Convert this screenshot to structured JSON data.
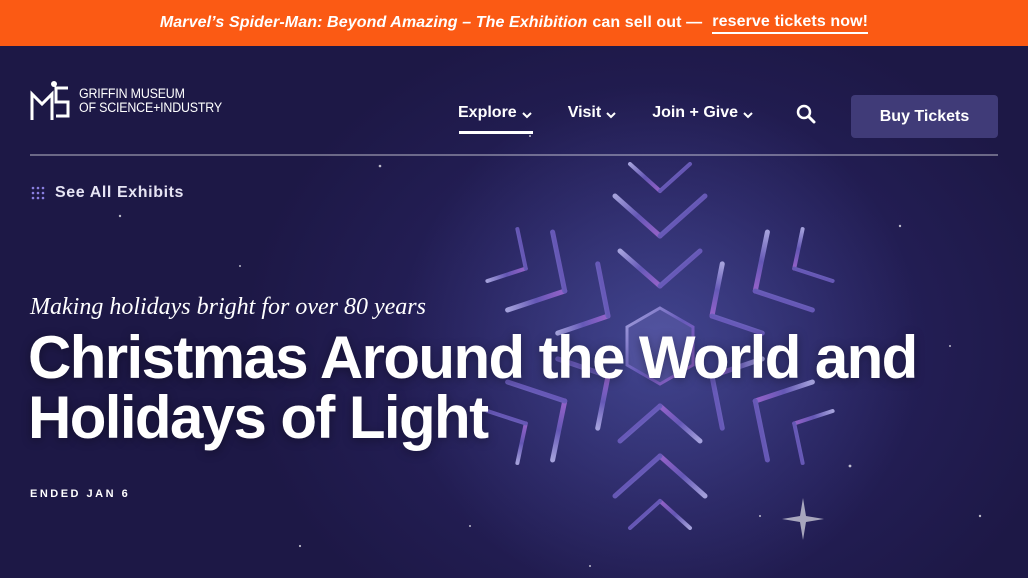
{
  "banner": {
    "italic_title": "Marvel’s Spider-Man: Beyond Amazing – The Exhibition",
    "text": "can sell out —",
    "link": "reserve tickets now!"
  },
  "logo": {
    "line1": "GRIFFIN MUSEUM",
    "line2": "OF SCIENCE+INDUSTRY"
  },
  "nav": {
    "items": [
      {
        "label": "Explore",
        "active": true
      },
      {
        "label": "Visit",
        "active": false
      },
      {
        "label": "Join + Give",
        "active": false
      }
    ],
    "buy_label": "Buy Tickets"
  },
  "see_all": "See All Exhibits",
  "hero": {
    "tagline": "Making holidays bright for over 80 years",
    "title": "Christmas Around the World and Holidays of Light",
    "status": "ENDED JAN 6"
  },
  "colors": {
    "banner": "#fb5a14",
    "background": "#1d1846",
    "button": "#403b78"
  }
}
